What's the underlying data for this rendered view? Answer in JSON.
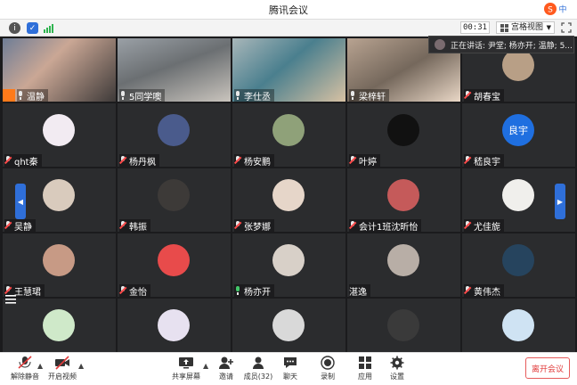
{
  "window": {
    "title": "腾讯会议"
  },
  "top": {
    "timer": "00:31",
    "view_label": "宫格视图"
  },
  "speaking": {
    "text": "正在讲话: 尹堂; 杨亦开; 温静; 5..."
  },
  "tiles": [
    {
      "name": "温静",
      "mic": "on",
      "kind": "video",
      "style": "v1",
      "host": true
    },
    {
      "name": "5同学噢",
      "mic": "on",
      "kind": "video",
      "style": "v2"
    },
    {
      "name": "李仕丞",
      "mic": "on",
      "kind": "video",
      "style": "v3"
    },
    {
      "name": "梁梓轩",
      "mic": "on",
      "kind": "video",
      "style": "v4"
    },
    {
      "name": "胡春宝",
      "mic": "off",
      "kind": "avatar",
      "color": "#b89f86"
    },
    {
      "name": "qht秦",
      "mic": "off",
      "kind": "avatar",
      "color": "#f2ebf2"
    },
    {
      "name": "杨丹枫",
      "mic": "off",
      "kind": "avatar",
      "color": "#4a5b8c"
    },
    {
      "name": "杨安鹏",
      "mic": "off",
      "kind": "avatar",
      "color": "#8fa179"
    },
    {
      "name": "叶婷",
      "mic": "off",
      "kind": "avatar",
      "color": "#111111"
    },
    {
      "name": "嵇良宇",
      "mic": "off",
      "kind": "avatar",
      "color": "#1f6fe0",
      "initials": "良宇"
    },
    {
      "name": "吴静",
      "mic": "off",
      "kind": "avatar",
      "color": "#d9cbbd"
    },
    {
      "name": "韩振",
      "mic": "off",
      "kind": "avatar",
      "color": "#3d3a38"
    },
    {
      "name": "张梦娜",
      "mic": "off",
      "kind": "avatar",
      "color": "#e6d6c9"
    },
    {
      "name": "会计1班沈昕怡",
      "mic": "off",
      "kind": "avatar",
      "color": "#c55a5a"
    },
    {
      "name": "尤佳旎",
      "mic": "off",
      "kind": "avatar",
      "color": "#f0efec"
    },
    {
      "name": "王慧珺",
      "mic": "off",
      "kind": "avatar",
      "color": "#c79a85"
    },
    {
      "name": "金怡",
      "mic": "off",
      "kind": "avatar",
      "color": "#e84b4b"
    },
    {
      "name": "杨亦开",
      "mic": "green",
      "kind": "avatar",
      "color": "#d8d0c8"
    },
    {
      "name": "湛逸",
      "mic": "none",
      "kind": "avatar",
      "color": "#b8aea6"
    },
    {
      "name": "黄伟杰",
      "mic": "off",
      "kind": "avatar",
      "color": "#26445e"
    },
    {
      "name": "",
      "mic": "none",
      "kind": "avatar",
      "color": "#cfe9c9"
    },
    {
      "name": "",
      "mic": "none",
      "kind": "avatar",
      "color": "#e7e1f0"
    },
    {
      "name": "",
      "mic": "none",
      "kind": "avatar",
      "color": "#d9d9d9"
    },
    {
      "name": "",
      "mic": "none",
      "kind": "avatar",
      "color": "#3a3a3a"
    },
    {
      "name": "",
      "mic": "none",
      "kind": "avatar",
      "color": "#cfe3f3"
    }
  ],
  "bottom": {
    "unmute": "解除静音",
    "video": "开启视频",
    "share": "共享屏幕",
    "invite": "邀请",
    "members": "成员(32)",
    "chat": "聊天",
    "record": "录制",
    "apps": "应用",
    "settings": "设置",
    "leave": "离开会议"
  },
  "colors": {
    "accent": "#2f6fd9",
    "danger": "#e13b3b",
    "host": "#ff7a1a"
  }
}
